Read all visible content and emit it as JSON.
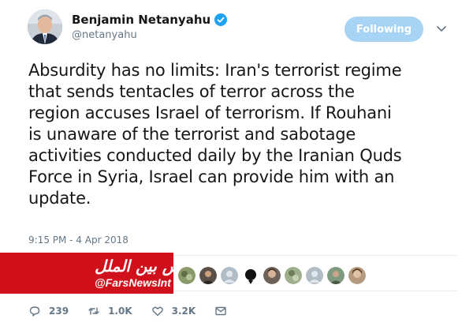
{
  "author": {
    "name": "Benjamin Netanyahu",
    "handle": "@netanyahu",
    "verified": true
  },
  "follow_button": {
    "label": "Following"
  },
  "tweet": {
    "lines": [
      "Absurdity has no limits: Iran's terrorist regime",
      "that sends tentacles of terror across the",
      "region accuses Israel of terrorism. If Rouhani",
      "is unaware of the terrorist and sabotage",
      "activities conducted daily by the Iranian Quds",
      "Force in Syria, Israel can provide him with an",
      "update."
    ],
    "timestamp": "9:15 PM - 4 Apr 2018"
  },
  "watermark": {
    "arabic_text": "فارس بين الملل",
    "latin_text": "@FarsNewsInt",
    "color": "#d0111b"
  },
  "likers": [
    {
      "icon": "profile-photo-icon"
    },
    {
      "icon": "profile-photo-icon"
    },
    {
      "icon": "default-avatar-icon"
    },
    {
      "icon": "silhouette-avatar-icon"
    },
    {
      "icon": "profile-photo-icon"
    },
    {
      "icon": "profile-photo-icon"
    },
    {
      "icon": "default-avatar-icon"
    },
    {
      "icon": "profile-photo-icon"
    },
    {
      "icon": "profile-photo-icon"
    }
  ],
  "actions": {
    "replies": "239",
    "retweets": "1.0K",
    "likes": "3.2K"
  },
  "colors": {
    "accent": "#1da1f2",
    "following_bg": "#a7d4f5",
    "muted": "#657786",
    "text": "#14171a"
  }
}
